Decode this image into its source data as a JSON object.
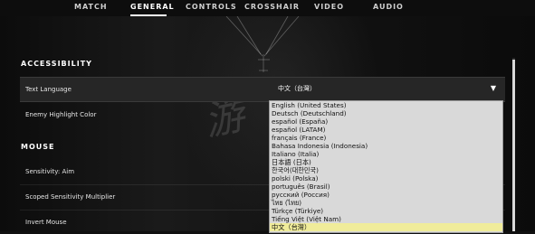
{
  "tabs": [
    {
      "label": "MATCH"
    },
    {
      "label": "GENERAL",
      "active": true
    },
    {
      "label": "CONTROLS"
    },
    {
      "label": "CROSSHAIR"
    },
    {
      "label": "VIDEO"
    },
    {
      "label": "AUDIO"
    }
  ],
  "sections": {
    "accessibility": "ACCESSIBILITY",
    "mouse": "MOUSE"
  },
  "rows": {
    "text_language": "Text Language",
    "enemy_highlight_color": "Enemy Highlight Color",
    "sensitivity_aim": "Sensitivity: Aim",
    "scoped_sensitivity": "Scoped Sensitivity Multiplier",
    "invert_mouse": "Invert Mouse"
  },
  "language_select": {
    "value": "中文（台灣）",
    "caret": "▼",
    "options": [
      "English (United States)",
      "Deutsch (Deutschland)",
      "español (España)",
      "español (LATAM)",
      "français (France)",
      "Bahasa Indonesia (Indonesia)",
      "Italiano (Italia)",
      "日本語 (日本)",
      "한국어(대한민국)",
      "polski (Polska)",
      "português (Brasil)",
      "русский (Россия)",
      "ไทย (ไทย)",
      "Türkçe (Türkiye)",
      "Tiếng Việt (Việt Nam)",
      "中文（台灣）"
    ],
    "selected_index": 15
  },
  "background_watermark": "游"
}
